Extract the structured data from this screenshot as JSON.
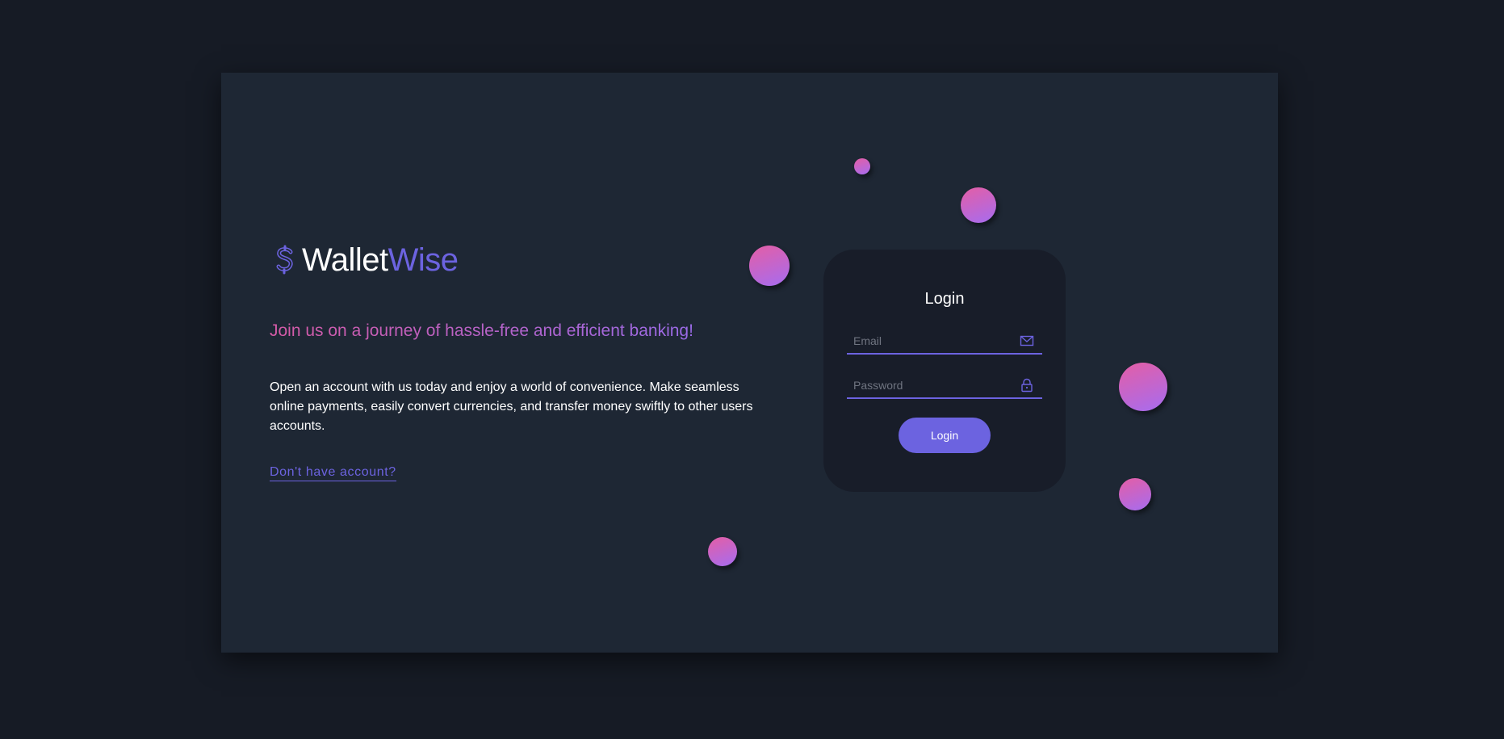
{
  "brand": {
    "name_part1": "Wallet",
    "name_part2": "Wise",
    "logo_icon": "dollar-sign-icon"
  },
  "hero": {
    "tagline": "Join us on a journey of hassle-free and efficient banking!",
    "description": "Open an account with us today and enjoy a world of convenience. Make seamless online payments, easily convert currencies, and transfer money swiftly to other users accounts.",
    "signup_link": "Don't have account?"
  },
  "login_form": {
    "title": "Login",
    "email_placeholder": "Email",
    "email_icon": "mail-icon",
    "password_placeholder": "Password",
    "password_icon": "lock-icon",
    "submit_label": "Login"
  },
  "colors": {
    "page_background": "#161b25",
    "panel_background": "#1e2734",
    "card_background": "#181d29",
    "accent": "#6c63e0",
    "gradient_start": "#e45ea5",
    "gradient_end": "#a66cf0",
    "text": "#ffffff"
  }
}
